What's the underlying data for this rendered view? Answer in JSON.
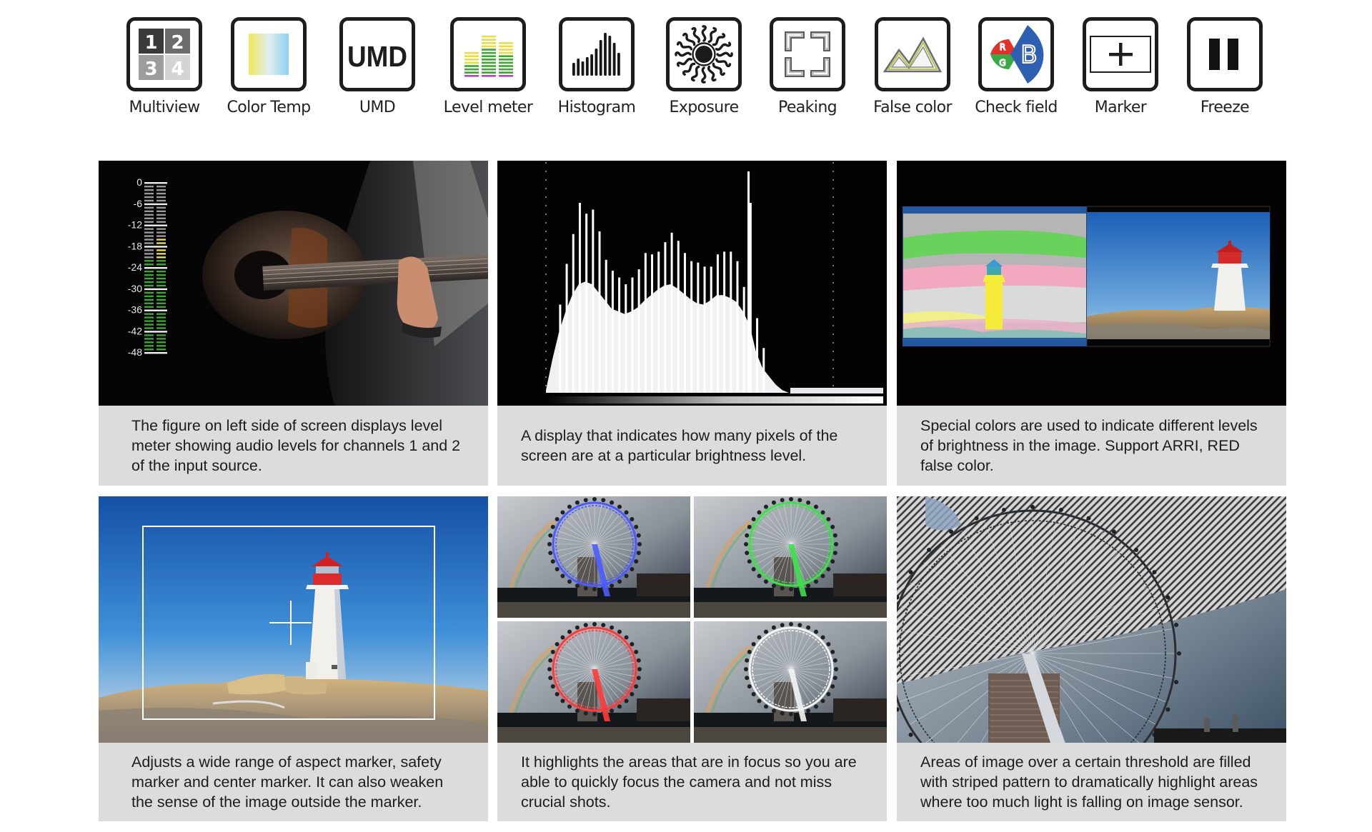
{
  "features": [
    {
      "id": "multiview",
      "label": "Multiview",
      "icon": "multiview-icon",
      "glyphs": [
        "1",
        "2",
        "3",
        "4"
      ]
    },
    {
      "id": "color-temp",
      "label": "Color Temp",
      "icon": "color-temp-icon"
    },
    {
      "id": "umd",
      "label": "UMD",
      "icon": "umd-icon",
      "glyph": "UMD"
    },
    {
      "id": "level-meter",
      "label": "Level meter",
      "icon": "level-meter-icon"
    },
    {
      "id": "histogram",
      "label": "Histogram",
      "icon": "histogram-icon"
    },
    {
      "id": "exposure",
      "label": "Exposure",
      "icon": "exposure-sun-icon"
    },
    {
      "id": "peaking",
      "label": "Peaking",
      "icon": "peaking-icon"
    },
    {
      "id": "false-color",
      "label": "False color",
      "icon": "false-color-mountain-icon"
    },
    {
      "id": "check-field",
      "label": "Check field",
      "icon": "check-field-rgb-icon",
      "glyphs": [
        "R",
        "G",
        "B"
      ]
    },
    {
      "id": "marker",
      "label": "Marker",
      "icon": "marker-crosshair-icon"
    },
    {
      "id": "freeze",
      "label": "Freeze",
      "icon": "freeze-pause-icon"
    }
  ],
  "colors": {
    "meter_green": "#3fa535",
    "meter_yellow": "#e8dc4a",
    "meter_gray": "#9a9a9a",
    "meter_white": "#f0f0f0",
    "rgb_red": "#e0312b",
    "rgb_green": "#3aa845",
    "rgb_blue": "#2f5fb0",
    "peaking_blue": "#4b5bff",
    "peaking_green": "#3ee04a",
    "peaking_red": "#ff3a3a",
    "peaking_white": "#f4f4f4",
    "caption_bg": "#dcdcdc"
  },
  "cards": [
    {
      "id": "level-meter",
      "image": "guitar-player-with-audio-level-meter",
      "caption": "The figure on left side of screen displays level meter showing audio levels for channels 1 and 2 of the input source.",
      "meter": {
        "scale_labels": [
          "0",
          "-6",
          "-12",
          "-18",
          "-24",
          "-30",
          "-36",
          "-42",
          "-48"
        ],
        "channels": 2,
        "segments_per_channel": 48,
        "ch1_yellow_from_db": null,
        "ch1_green_from_db": -22,
        "ch2_yellow_from_db": -16,
        "ch2_green_from_db": -22
      }
    },
    {
      "id": "histogram",
      "image": "luminance-histogram",
      "caption": "A display that indicates how many pixels of the screen are at a particular brightness level."
    },
    {
      "id": "false-color",
      "image": "lighthouse-false-color-vs-original",
      "caption": "Special colors are used to indicate different levels of brightness in the image. Support ARRI, RED false color."
    },
    {
      "id": "marker",
      "image": "lighthouse-with-safety-marker-and-center-cross",
      "caption": "Adjusts a wide range of aspect marker, safety marker and center marker. It can also weaken the sense of the image outside the marker."
    },
    {
      "id": "peaking",
      "image": "ferris-wheel-focus-peaking-4-colors",
      "caption": "It highlights the areas that are in focus so you are able to quickly focus the camera and not miss crucial shots.",
      "peaking_colors": [
        "blue",
        "green",
        "red",
        "white"
      ]
    },
    {
      "id": "zebra",
      "image": "ferris-wheel-zebra-stripes",
      "caption": "Areas of image over a certain threshold are filled with striped pattern to dramatically highlight areas where too much light is falling on image sensor."
    }
  ]
}
